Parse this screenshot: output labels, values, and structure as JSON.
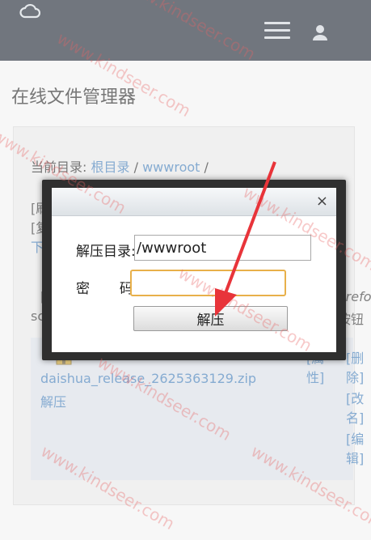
{
  "header": {
    "logo_icon": "cloud-icon",
    "menu_icon": "hamburger-menu-icon",
    "user_icon": "user-icon"
  },
  "page": {
    "title": "在线文件管理器"
  },
  "breadcrumb": {
    "prefix": "当前目录:",
    "root": "根目录",
    "sep1": "/",
    "folder": "wwwroot",
    "sep2": "/"
  },
  "obscured": {
    "line1": "[刷",
    "line2": "[复",
    "line3": "下载",
    "line4a": "[",
    "line4b": "sc",
    "right_a": "Firefo",
    "right_b": "按钮"
  },
  "file": {
    "icon": "zip-file-icon",
    "name": "daishua_release_2625363129.zip",
    "extract": "解压",
    "attr_a": "[属",
    "attr_b": "性]",
    "del_a": "[删",
    "del_b": "除]",
    "rename_a": "[改",
    "rename_b": "名]",
    "edit_a": "[编",
    "edit_b": "辑]"
  },
  "dialog": {
    "close": "×",
    "dir_label": "解压目录:",
    "dir_value": "/wwwroot",
    "pwd_label_a": "密",
    "pwd_label_b": "码:",
    "pwd_value": "",
    "submit": "解压"
  },
  "watermark": "www.kindseer.com",
  "colors": {
    "header_bg": "#1b2330",
    "link": "#3b78b5",
    "arrow": "#e8343a",
    "focus_border": "#e8b04a"
  }
}
